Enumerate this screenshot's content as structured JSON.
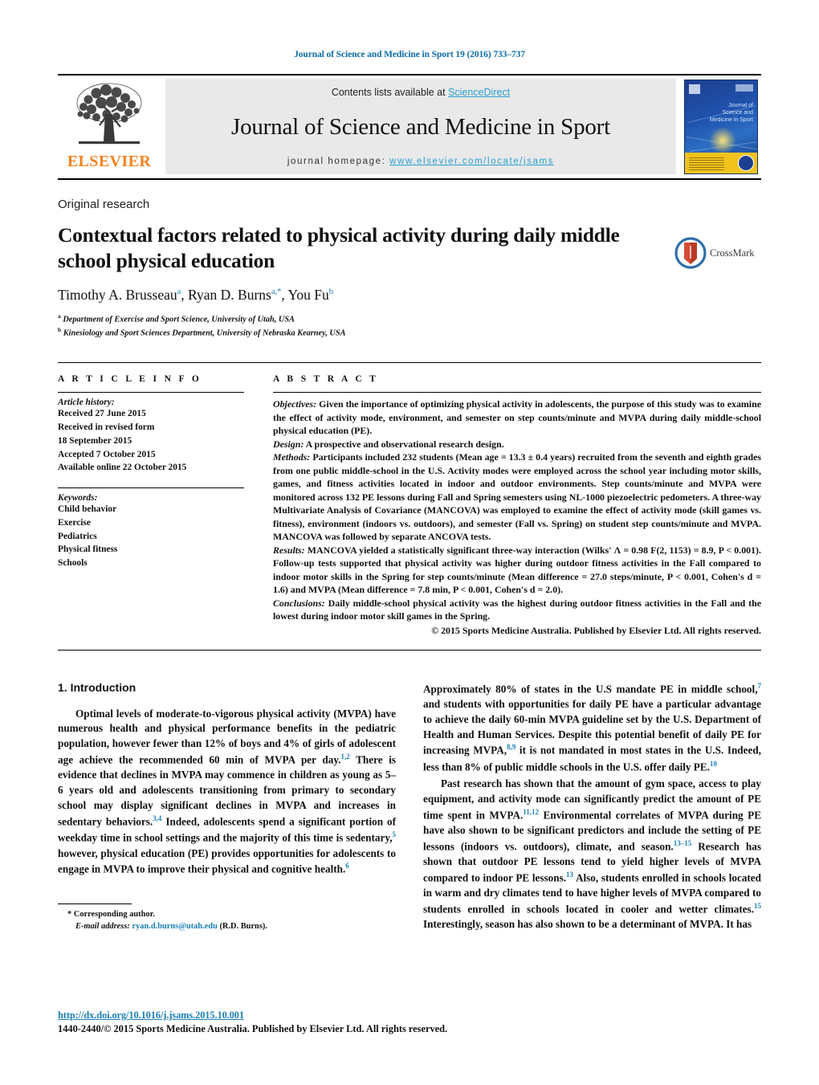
{
  "running_head": "Journal of Science and Medicine in Sport 19 (2016) 733–737",
  "masthead": {
    "publisher_name": "ELSEVIER",
    "contents_prefix": "Contents lists available at ",
    "contents_link": "ScienceDirect",
    "journal_title": "Journal of Science and Medicine in Sport",
    "homepage_prefix": "journal homepage: ",
    "homepage_url": "www.elsevier.com/locate/jsams",
    "cover_title": "Journal of Science and Medicine in Sport"
  },
  "article": {
    "type": "Original research",
    "title": "Contextual factors related to physical activity during daily middle school physical education",
    "authors": "Timothy A. Brusseau, Ryan D. Burns, You Fu",
    "author_list": [
      {
        "name": "Timothy A. Brusseau",
        "marks": "a"
      },
      {
        "name": "Ryan D. Burns",
        "marks": "a,*"
      },
      {
        "name": "You Fu",
        "marks": "b"
      }
    ],
    "affiliations": [
      {
        "mark": "a",
        "text": "Department of Exercise and Sport Science, University of Utah, USA"
      },
      {
        "mark": "b",
        "text": "Kinesiology and Sport Sciences Department, University of Nebraska Kearney, USA"
      }
    ],
    "crossmark_label": "CrossMark"
  },
  "info": {
    "section_label": "A R T I C L E    I N F O",
    "history_heading": "Article history:",
    "history_lines": [
      "Received 27 June 2015",
      "Received in revised form",
      "18 September 2015",
      "Accepted 7 October 2015",
      "Available online 22 October 2015"
    ],
    "keywords_heading": "Keywords:",
    "keywords": [
      "Child behavior",
      "Exercise",
      "Pediatrics",
      "Physical fitness",
      "Schools"
    ]
  },
  "abstract": {
    "section_label": "A B S T R A C T",
    "objectives_label": "Objectives:",
    "objectives_text": " Given the importance of optimizing physical activity in adolescents, the purpose of this study was to examine the effect of activity mode, environment, and semester on step counts/minute and MVPA during daily middle-school physical education (PE).",
    "design_label": "Design:",
    "design_text": " A prospective and observational research design.",
    "methods_label": "Methods:",
    "methods_text": " Participants included 232 students (Mean age = 13.3 ± 0.4 years) recruited from the seventh and eighth grades from one public middle-school in the U.S. Activity modes were employed across the school year including motor skills, games, and fitness activities located in indoor and outdoor environments. Step counts/minute and MVPA were monitored across 132 PE lessons during Fall and Spring semesters using NL-1000 piezoelectric pedometers. A three-way Multivariate Analysis of Covariance (MANCOVA) was employed to examine the effect of activity mode (skill games vs. fitness), environment (indoors vs. outdoors), and semester (Fall vs. Spring) on student step counts/minute and MVPA. MANCOVA was followed by separate ANCOVA tests.",
    "results_label": "Results:",
    "results_text": " MANCOVA yielded a statistically significant three-way interaction (Wilks' Λ = 0.98 F(2, 1153) = 8.9, P < 0.001). Follow-up tests supported that physical activity was higher during outdoor fitness activities in the Fall compared to indoor motor skills in the Spring for step counts/minute (Mean difference = 27.0 steps/minute, P < 0.001, Cohen's d = 1.6) and MVPA (Mean difference = 7.8 min, P < 0.001, Cohen's d = 2.0).",
    "conclusions_label": "Conclusions:",
    "conclusions_text": " Daily middle-school physical activity was the highest during outdoor fitness activities in the Fall and the lowest during indoor motor skill games in the Spring.",
    "copyright": "© 2015 Sports Medicine Australia. Published by Elsevier Ltd. All rights reserved."
  },
  "body": {
    "section_number_title": "1.  Introduction",
    "left_paragraph_1": "Optimal levels of moderate-to-vigorous physical activity (MVPA) have numerous health and physical performance benefits in the pediatric population, however fewer than 12% of boys and 4% of girls of adolescent age achieve the recommended 60 min of MVPA per day.",
    "left_p1_ref_a": "1,2",
    "left_paragraph_1b": " There is evidence that declines in MVPA may commence in children as young as 5–6 years old and adolescents transitioning from primary to secondary school may display significant declines in MVPA and increases in sedentary behaviors.",
    "left_p1_ref_b": "3,4",
    "left_paragraph_1c": " Indeed, adolescents spend a significant portion of weekday time in school settings and the majority of this time is sedentary,",
    "left_p1_ref_c": "5",
    "left_paragraph_1d": " however, physical education (PE) provides opportunities for adolescents to engage in MVPA to improve their physical and cognitive health.",
    "left_p1_ref_d": "6",
    "right_paragraph_1": "Approximately 80% of states in the U.S mandate PE in middle school,",
    "right_p1_ref_a": "7",
    "right_paragraph_1b": " and students with opportunities for daily PE have a particular advantage to achieve the daily 60-min MVPA guideline set by the U.S. Department of Health and Human Services. Despite this potential benefit of daily PE for increasing MVPA,",
    "right_p1_ref_b": "8,9",
    "right_paragraph_1c": " it is not mandated in most states in the U.S. Indeed, less than 8% of public middle schools in the U.S. offer daily PE.",
    "right_p1_ref_c": "10",
    "right_paragraph_2": "Past research has shown that the amount of gym space, access to play equipment, and activity mode can significantly predict the amount of PE time spent in MVPA.",
    "right_p2_ref_a": "11,12",
    "right_paragraph_2b": " Environmental correlates of MVPA during PE have also shown to be significant predictors and include the setting of PE lessons (indoors vs. outdoors), climate, and season.",
    "right_p2_ref_b": "13–15",
    "right_paragraph_2c": " Research has shown that outdoor PE lessons tend to yield higher levels of MVPA compared to indoor PE lessons.",
    "right_p2_ref_c": "13",
    "right_paragraph_2d": " Also, students enrolled in schools located in warm and dry climates tend to have higher levels of MVPA compared to students enrolled in schools located in cooler and wetter climates.",
    "right_p2_ref_d": "15",
    "right_paragraph_2e": " Interestingly, season has also shown to be a determinant of MVPA. It has"
  },
  "footnote": {
    "corresponding_marker": "*",
    "corresponding_label": "Corresponding author.",
    "email_label": "E-mail address:",
    "email": "ryan.d.burns@utah.edu",
    "email_suffix": "(R.D. Burns)."
  },
  "footer": {
    "doi": "http://dx.doi.org/10.1016/j.jsams.2015.10.001",
    "issn_line": "1440-2440/© 2015 Sports Medicine Australia. Published by Elsevier Ltd. All rights reserved."
  },
  "colors": {
    "link_blue": "#1a7fb5",
    "sciencedirect_blue": "#2a9fd0",
    "elsevier_orange": "#f58220",
    "running_head_blue": "#0b6ca8"
  }
}
